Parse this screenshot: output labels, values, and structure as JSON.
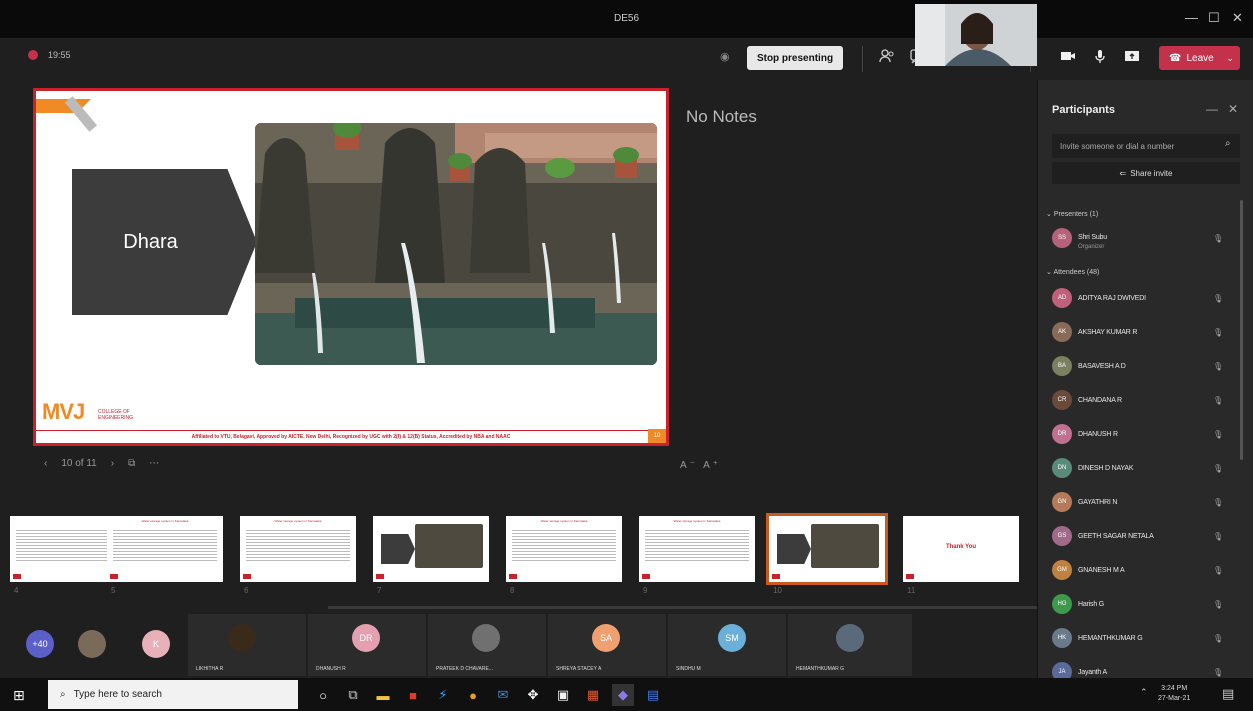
{
  "window": {
    "title": "DE56",
    "minimize": "—",
    "maximize": "☐",
    "close": "✕"
  },
  "toolbar": {
    "elapsed": "19:55",
    "stop_presenting": "Stop presenting",
    "leave": "Leave",
    "eye_icon": "eye-icon",
    "icons": [
      "participants-icon",
      "chat-icon",
      "raise-hand-icon",
      "rooms-icon",
      "more-icon",
      "camera-icon",
      "mic-icon",
      "share-icon"
    ]
  },
  "slide": {
    "label": "Dhara",
    "logo": "MVJ",
    "logo_sub": "COLLEGE OF ENGINEERING",
    "footer": "Affiliated to VTU, Belagavi, Approved by AICTE, New Delhi, Recognized by UGC with 2(f) & 12(B) Status, Accredited by NBA and NAAC",
    "page": "10"
  },
  "notes": "No Notes",
  "slide_nav": {
    "counter": "10 of 11",
    "font_size_label": "A⁻ A⁺"
  },
  "thumbnails": [
    {
      "num": "4",
      "kind": "text"
    },
    {
      "num": "5",
      "kind": "text",
      "title": "Water storage system in Karnataka"
    },
    {
      "num": "6",
      "kind": "text",
      "title": "Water storage system in Karnataka"
    },
    {
      "num": "7",
      "kind": "image"
    },
    {
      "num": "8",
      "kind": "text",
      "title": "Water storage system in Karnataka"
    },
    {
      "num": "9",
      "kind": "text",
      "title": "Water storage system in Karnataka"
    },
    {
      "num": "10",
      "kind": "image",
      "active": true
    },
    {
      "num": "11",
      "kind": "thanks",
      "title": "Thank You"
    }
  ],
  "participants": {
    "title": "Participants",
    "invite_placeholder": "Invite someone or dial a number",
    "share_invite": "Share invite",
    "presenters_label": "Presenters (1)",
    "attendees_label": "Attendees (48)",
    "presenter": {
      "name": "Shri Subu",
      "role": "Organizer",
      "initials": "SS",
      "color": "#b5627a"
    },
    "attendees": [
      {
        "name": "ADITYA RAJ DWIVEDI",
        "initials": "AD",
        "color": "#c0607a"
      },
      {
        "name": "AKSHAY KUMAR R",
        "initials": "AK",
        "color": "#8a6b5a"
      },
      {
        "name": "BASAVESH A D",
        "initials": "BA",
        "color": "#7a8060"
      },
      {
        "name": "CHANDANA R",
        "initials": "CR",
        "color": "#6a4a3a"
      },
      {
        "name": "DHANUSH R",
        "initials": "DR",
        "color": "#c07090"
      },
      {
        "name": "DINESH D NAYAK",
        "initials": "DN",
        "color": "#5a8a7a"
      },
      {
        "name": "GAYATHRI N",
        "initials": "GN",
        "color": "#b57a5a"
      },
      {
        "name": "GEETH SAGAR NETALA",
        "initials": "GS",
        "color": "#a06a8a"
      },
      {
        "name": "GNANESH M A",
        "initials": "GM",
        "color": "#c08040"
      },
      {
        "name": "Harish G",
        "initials": "HG",
        "color": "#3c9a4a"
      },
      {
        "name": "HEMANTHKUMAR G",
        "initials": "HK",
        "color": "#6a7a8a"
      },
      {
        "name": "Jayanth A",
        "initials": "JA",
        "color": "#5a6a9a"
      }
    ]
  },
  "video_strip": [
    {
      "initials": "+40",
      "color": "#5b5fc7",
      "name": ""
    },
    {
      "initials": "",
      "color": "#7a6a5a",
      "name": ""
    },
    {
      "initials": "K",
      "color": "#e8b0b8",
      "name": ""
    },
    {
      "initials": "",
      "color": "#3a2a1a",
      "name": "LIKHITHA R"
    },
    {
      "initials": "DR",
      "color": "#e4a0b0",
      "name": "DHANUSH R"
    },
    {
      "initials": "",
      "color": "#707070",
      "name": "PRATEEK D CHAVARE..."
    },
    {
      "initials": "SA",
      "color": "#f0a070",
      "name": "SHREYA STACEY A"
    },
    {
      "initials": "SM",
      "color": "#6ab0d8",
      "name": "SINDHU M"
    },
    {
      "initials": "",
      "color": "#5a6a7a",
      "name": "HEMANTHKUMAR G"
    }
  ],
  "taskbar": {
    "search_placeholder": "Type here to search",
    "time": "3:24 PM",
    "date": "27-Mar-21"
  }
}
